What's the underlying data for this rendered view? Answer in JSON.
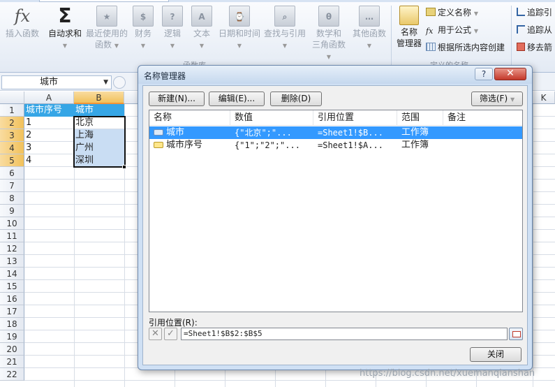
{
  "ribbon": {
    "buttons": [
      {
        "id": "insert-function",
        "label": "插入函数",
        "glyph": "fx"
      },
      {
        "id": "autosum",
        "label": "自动求和",
        "glyph": "Σ"
      },
      {
        "id": "recently-used",
        "label1": "最近使用的",
        "label2": "函数"
      },
      {
        "id": "financial",
        "label": "财务",
        "glyph": "$"
      },
      {
        "id": "logical",
        "label": "逻辑",
        "glyph": "?"
      },
      {
        "id": "text",
        "label": "文本",
        "glyph": "A"
      },
      {
        "id": "datetime",
        "label": "日期和时间",
        "glyph": "⌚"
      },
      {
        "id": "lookup",
        "label": "查找与引用",
        "glyph": "🔍"
      },
      {
        "id": "math",
        "label1": "数学和",
        "label2": "三角函数",
        "glyph": "θ"
      },
      {
        "id": "more",
        "label": "其他函数",
        "glyph": "…"
      }
    ],
    "group_function_library": "函数库",
    "name_manager": {
      "label1": "名称",
      "label2": "管理器"
    },
    "define_name": "定义名称",
    "use_in_formula": "用于公式",
    "create_from_selection": "根据所选内容创建",
    "group_defined_names": "定义的名称",
    "trace_precedents": "追踪引",
    "trace_dependents": "追踪从",
    "remove_arrows": "移去箭"
  },
  "formula_bar": {
    "name_box": "城市"
  },
  "sheet": {
    "columns": [
      "A",
      "B",
      "K"
    ],
    "rows": [
      "1",
      "2",
      "3",
      "4",
      "5",
      "6",
      "7",
      "8",
      "9",
      "10",
      "11",
      "12",
      "13",
      "14",
      "15",
      "16",
      "17",
      "18",
      "19",
      "20",
      "21",
      "22"
    ],
    "cells": {
      "A1": "城市序号",
      "B1": "城市",
      "A2": "1",
      "B2": "北京",
      "A3": "2",
      "B3": "上海",
      "A4": "3",
      "B4": "广州",
      "A5": "4",
      "B5": "深圳"
    }
  },
  "dialog": {
    "title": "名称管理器",
    "help": "?",
    "close": "✕",
    "buttons": {
      "new": "新建(N)...",
      "edit": "编辑(E)...",
      "delete": "删除(D)",
      "filter": "筛选(F)",
      "close": "关闭"
    },
    "columns": {
      "name": "名称",
      "value": "数值",
      "refers_to": "引用位置",
      "scope": "范围",
      "comment": "备注"
    },
    "rows": [
      {
        "name": "城市",
        "value": "{\"北京\";\"...",
        "refers_to": "=Sheet1!$B...",
        "scope": "工作簿",
        "comment": "",
        "selected": true
      },
      {
        "name": "城市序号",
        "value": "{\"1\";\"2\";\"...",
        "refers_to": "=Sheet1!$A...",
        "scope": "工作簿",
        "comment": "",
        "selected": false
      }
    ],
    "refers_to_label": "引用位置(R):",
    "refers_to_value": "=Sheet1!$B$2:$B$5"
  },
  "watermark": "https://blog.csdn.net/xuemanqianshan",
  "colors": {
    "header_fill": "#36a6e6",
    "selection_fill": "#c9ddf3",
    "list_selected": "#3399ff"
  }
}
